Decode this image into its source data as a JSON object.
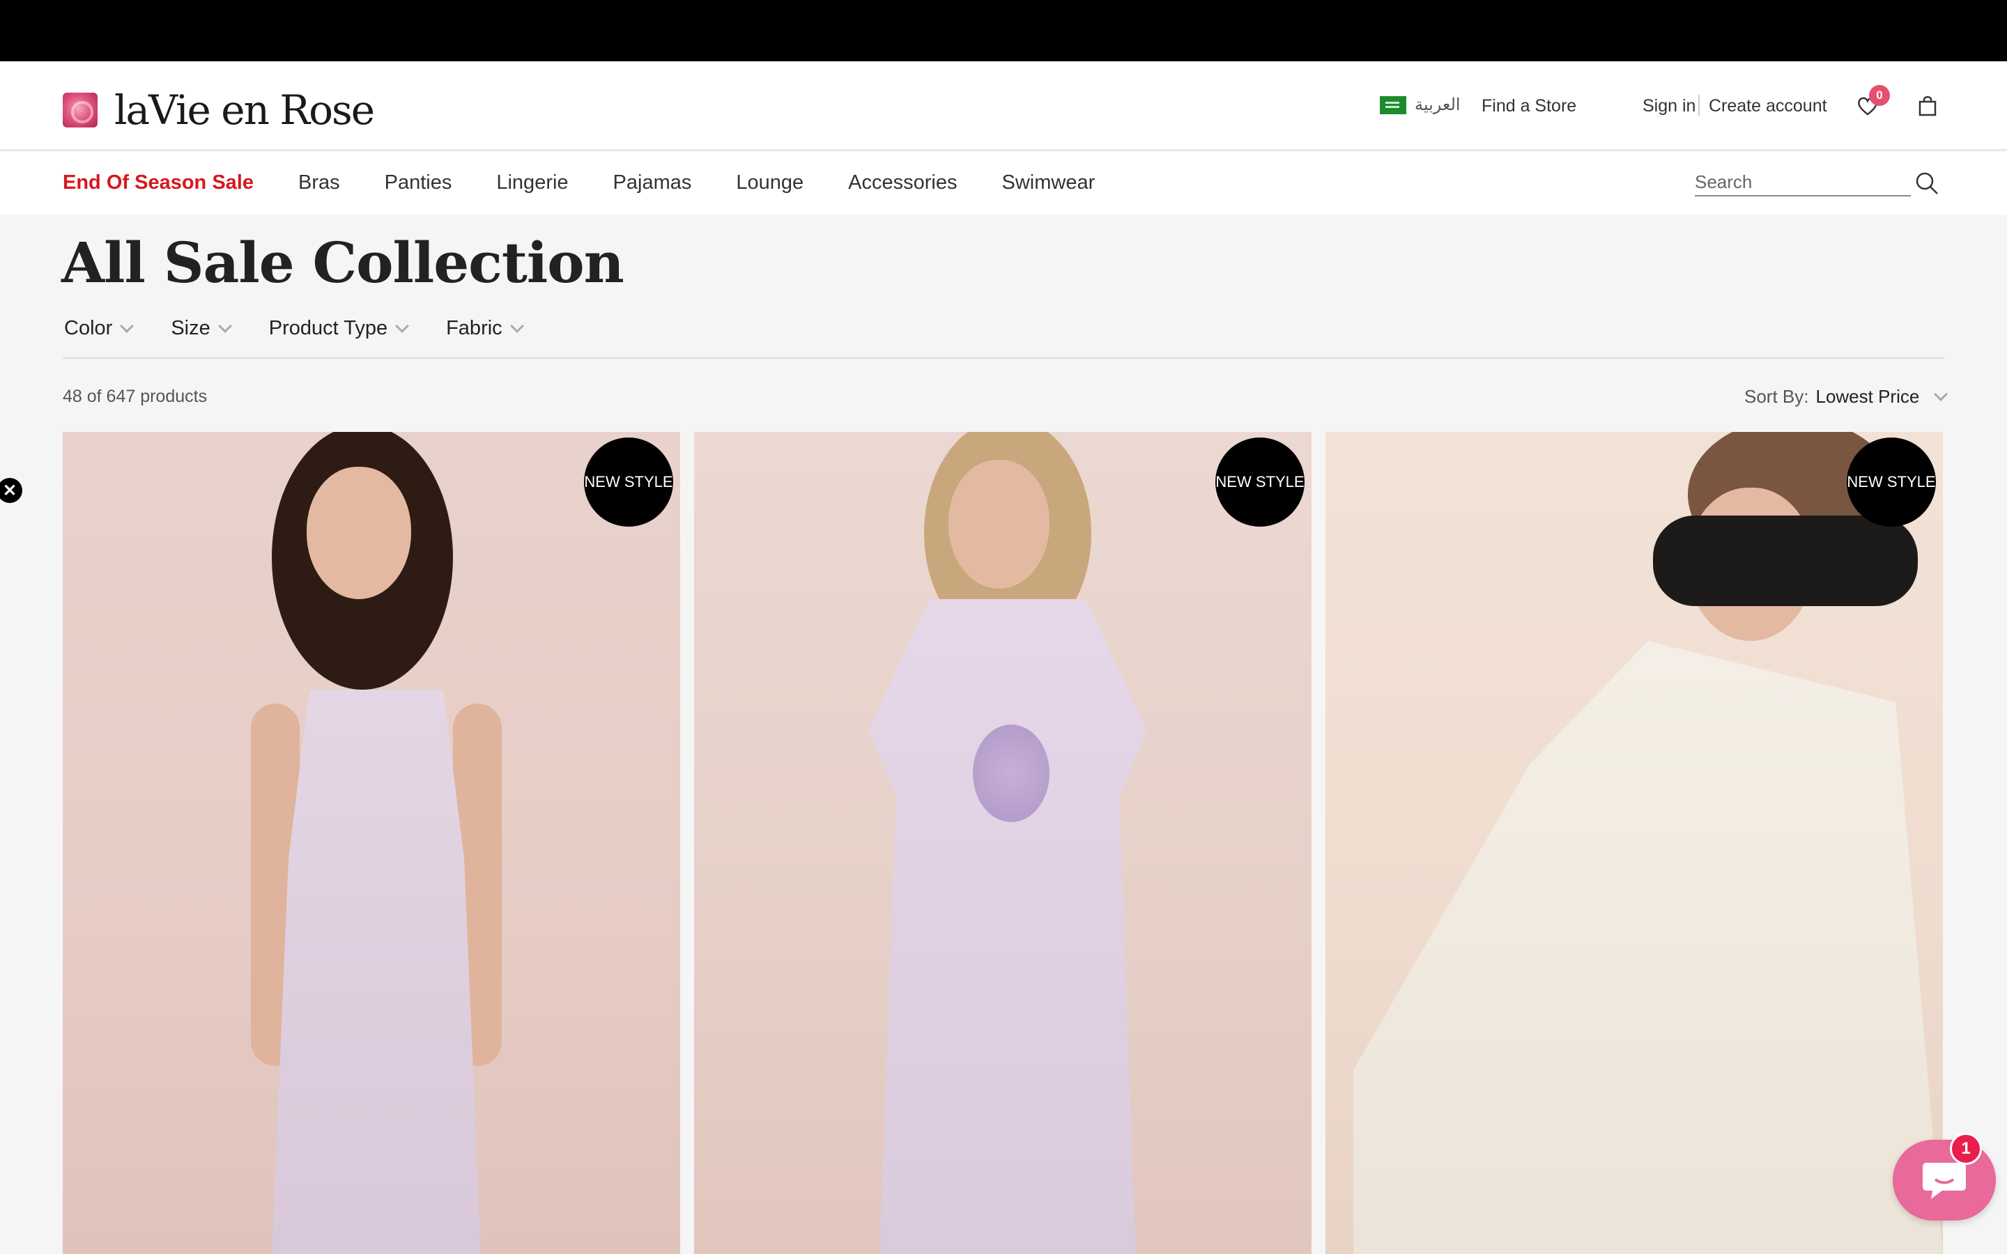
{
  "header": {
    "logo_text": "laVie en Rose",
    "language_label": "العربية",
    "find_store": "Find a Store",
    "sign_in": "Sign in",
    "create_account": "Create account",
    "wishlist_count": "0"
  },
  "nav": {
    "items": [
      {
        "label": "End Of Season Sale"
      },
      {
        "label": "Bras"
      },
      {
        "label": "Panties"
      },
      {
        "label": "Lingerie"
      },
      {
        "label": "Pajamas"
      },
      {
        "label": "Lounge"
      },
      {
        "label": "Accessories"
      },
      {
        "label": "Swimwear"
      }
    ],
    "search_placeholder": "Search"
  },
  "page": {
    "title": "All Sale Collection",
    "filters": [
      "Color",
      "Size",
      "Product Type",
      "Fabric"
    ],
    "product_count": "48 of 647 products",
    "sort_label": "Sort By:",
    "sort_value": "Lowest Price"
  },
  "products": [
    {
      "badge": "NEW STYLE"
    },
    {
      "badge": "NEW STYLE"
    },
    {
      "badge": "NEW STYLE"
    }
  ],
  "chat": {
    "unread": "1"
  },
  "colors": {
    "sale_red": "#d6181d",
    "badge_pink": "#e5506e",
    "chat_pink": "#e8699a"
  }
}
